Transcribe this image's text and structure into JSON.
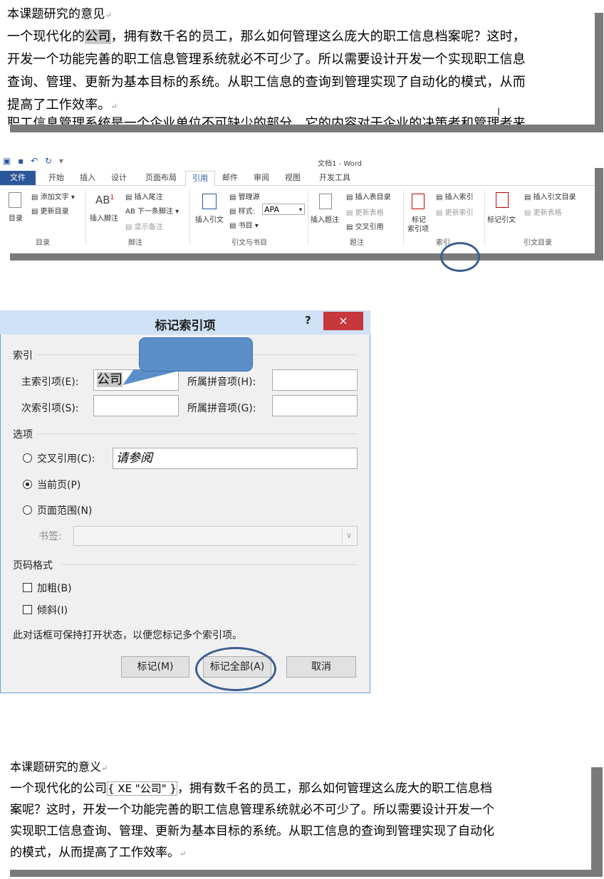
{
  "doc_top": {
    "heading": "本课题研究的意见",
    "lines": [
      "一个现代化的",
      "公司",
      "，拥有数千名的员工，那么如何管理这么庞大的职工信息档案呢？这时，",
      "开发一个功能完善的职工信息管理系统就必不可少了。所以需要设计开发一个实现职工信息",
      "查询、管理、更新为基本目标的系统。从职工信息的查询到管理实现了自动化的模式，从而",
      "提高了工作效率。",
      "职工信息管理系统是一个企业单位不可缺少的部分，它的内容对于企业的决策者和管理者来"
    ]
  },
  "ribbon": {
    "window_title": "文档1 - Word",
    "tabs": [
      "文件",
      "开始",
      "插入",
      "设计",
      "页面布局",
      "引用",
      "邮件",
      "审阅",
      "视图",
      "开发工具"
    ],
    "active_tab": "引用",
    "toc": {
      "big": "目录",
      "add_text": "添加文字",
      "update": "更新目录",
      "group": "目录"
    },
    "footnotes": {
      "insert_footnote": "插入脚注",
      "insert_endnote": "插入尾注",
      "next_footnote": "下一条脚注",
      "show_notes": "显示备注",
      "group": "脚注",
      "ab_label": "AB"
    },
    "citations": {
      "insert_citation": "插入引文",
      "manage_sources": "管理源",
      "style_label": "样式:",
      "style_value": "APA",
      "bibliography": "书目",
      "group": "引文与书目"
    },
    "captions": {
      "insert_caption": "插入题注",
      "insert_tof": "插入表目录",
      "update_table": "更新表格",
      "cross_ref": "交叉引用",
      "group": "题注"
    },
    "index": {
      "mark_entry_line1": "标记",
      "mark_entry_line2": "索引项",
      "insert_index": "插入索引",
      "update_index": "更新索引",
      "group": "索引"
    },
    "toa": {
      "mark_citation": "标记引文",
      "insert_toa": "插入引文目录",
      "update_table": "更新表格",
      "group": "引文目录"
    }
  },
  "dialog": {
    "title": "标记索引项",
    "help": "?",
    "close": "×",
    "index_section": "索引",
    "main_entry_label": "主索引项(E):",
    "main_entry_value": "公司",
    "main_pinyin_label": "所属拼音项(H):",
    "sub_entry_label": "次索引项(S):",
    "sub_pinyin_label": "所属拼音项(G):",
    "options_section": "选项",
    "cross_ref_label": "交叉引用(C):",
    "cross_ref_value": "请参阅",
    "current_page_label": "当前页(P)",
    "page_range_label": "页面范围(N)",
    "bookmark_label": "书签:",
    "format_section": "页码格式",
    "bold_label": "加粗(B)",
    "italic_label": "倾斜(I)",
    "note": "此对话框可保持打开状态，以便您标记多个索引项。",
    "mark_button": "标记(M)",
    "mark_all_button": "标记全部(A)",
    "cancel_button": "取消"
  },
  "doc_bottom": {
    "heading": "本课题研究的意义",
    "pre": "一个现代化的公司",
    "field": "{ XE \"公司\" }",
    "post": "，拥有数千名的员工，那么如何管理这么庞大的职工信息档",
    "lines": [
      "案呢？这时，开发一个功能完善的职工信息管理系统就必不可少了。所以需要设计开发一个",
      "实现职工信息查询、管理、更新为基本目标的系统。从职工信息的查询到管理实现了自动化",
      "的模式，从而提高了工作效率。"
    ]
  },
  "colors": {
    "ribbon_blue": "#2b579a",
    "close_red": "#c7373b",
    "callout_blue": "#5b8fc9",
    "ring_blue": "#3d5f8f"
  }
}
